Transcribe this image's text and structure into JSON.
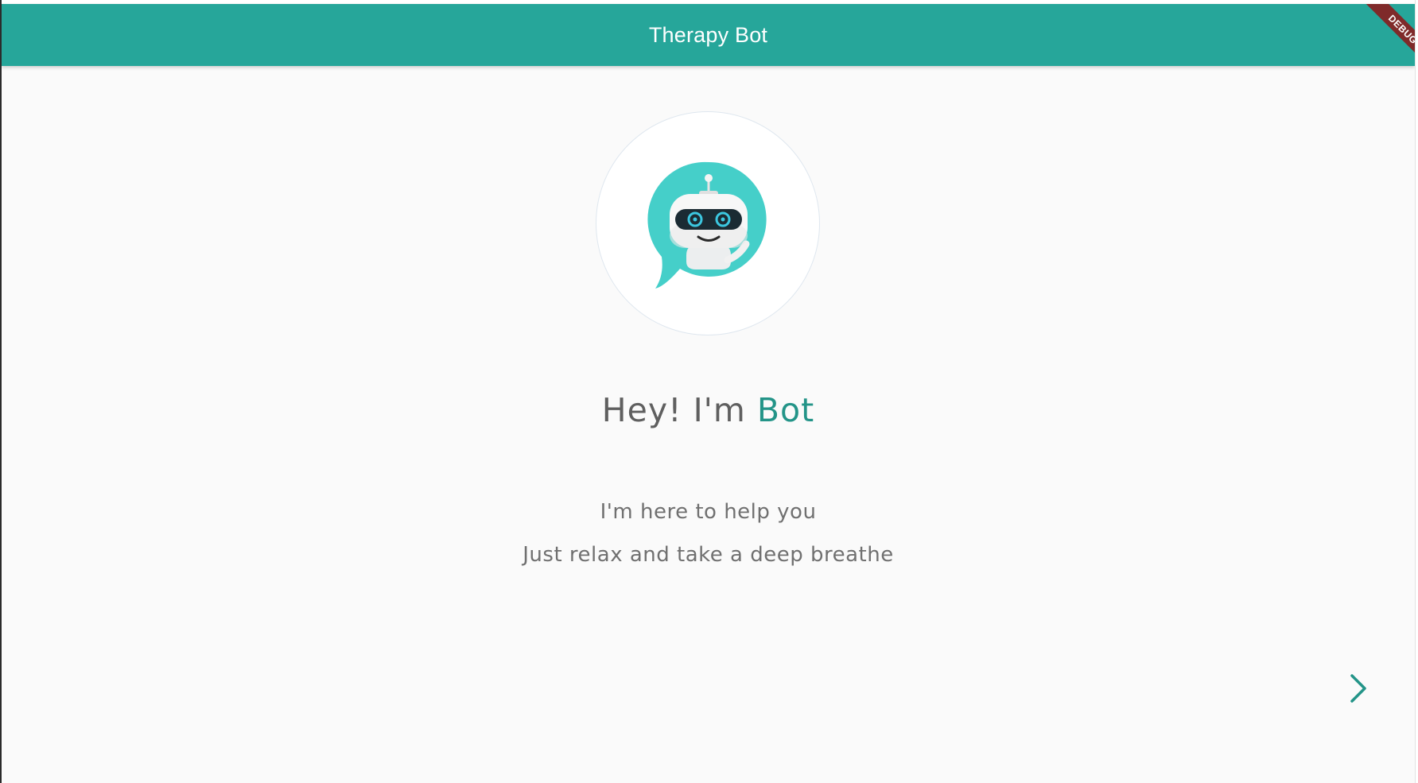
{
  "appbar": {
    "title": "Therapy Bot",
    "color": "#26a69a"
  },
  "debug_banner": {
    "label": "DEBUG",
    "color": "#7f2a2a"
  },
  "avatar": {
    "icon": "robot-chat-bubble-icon",
    "accent_color": "#45cfc9"
  },
  "greeting": {
    "prefix": "Hey! I'm",
    "name": "Bot",
    "name_color": "#239488"
  },
  "messages": [
    "I'm here to help you",
    "Just relax and take a deep breathe"
  ],
  "navigation": {
    "next_icon": "chevron-right-icon",
    "color": "#239488"
  }
}
